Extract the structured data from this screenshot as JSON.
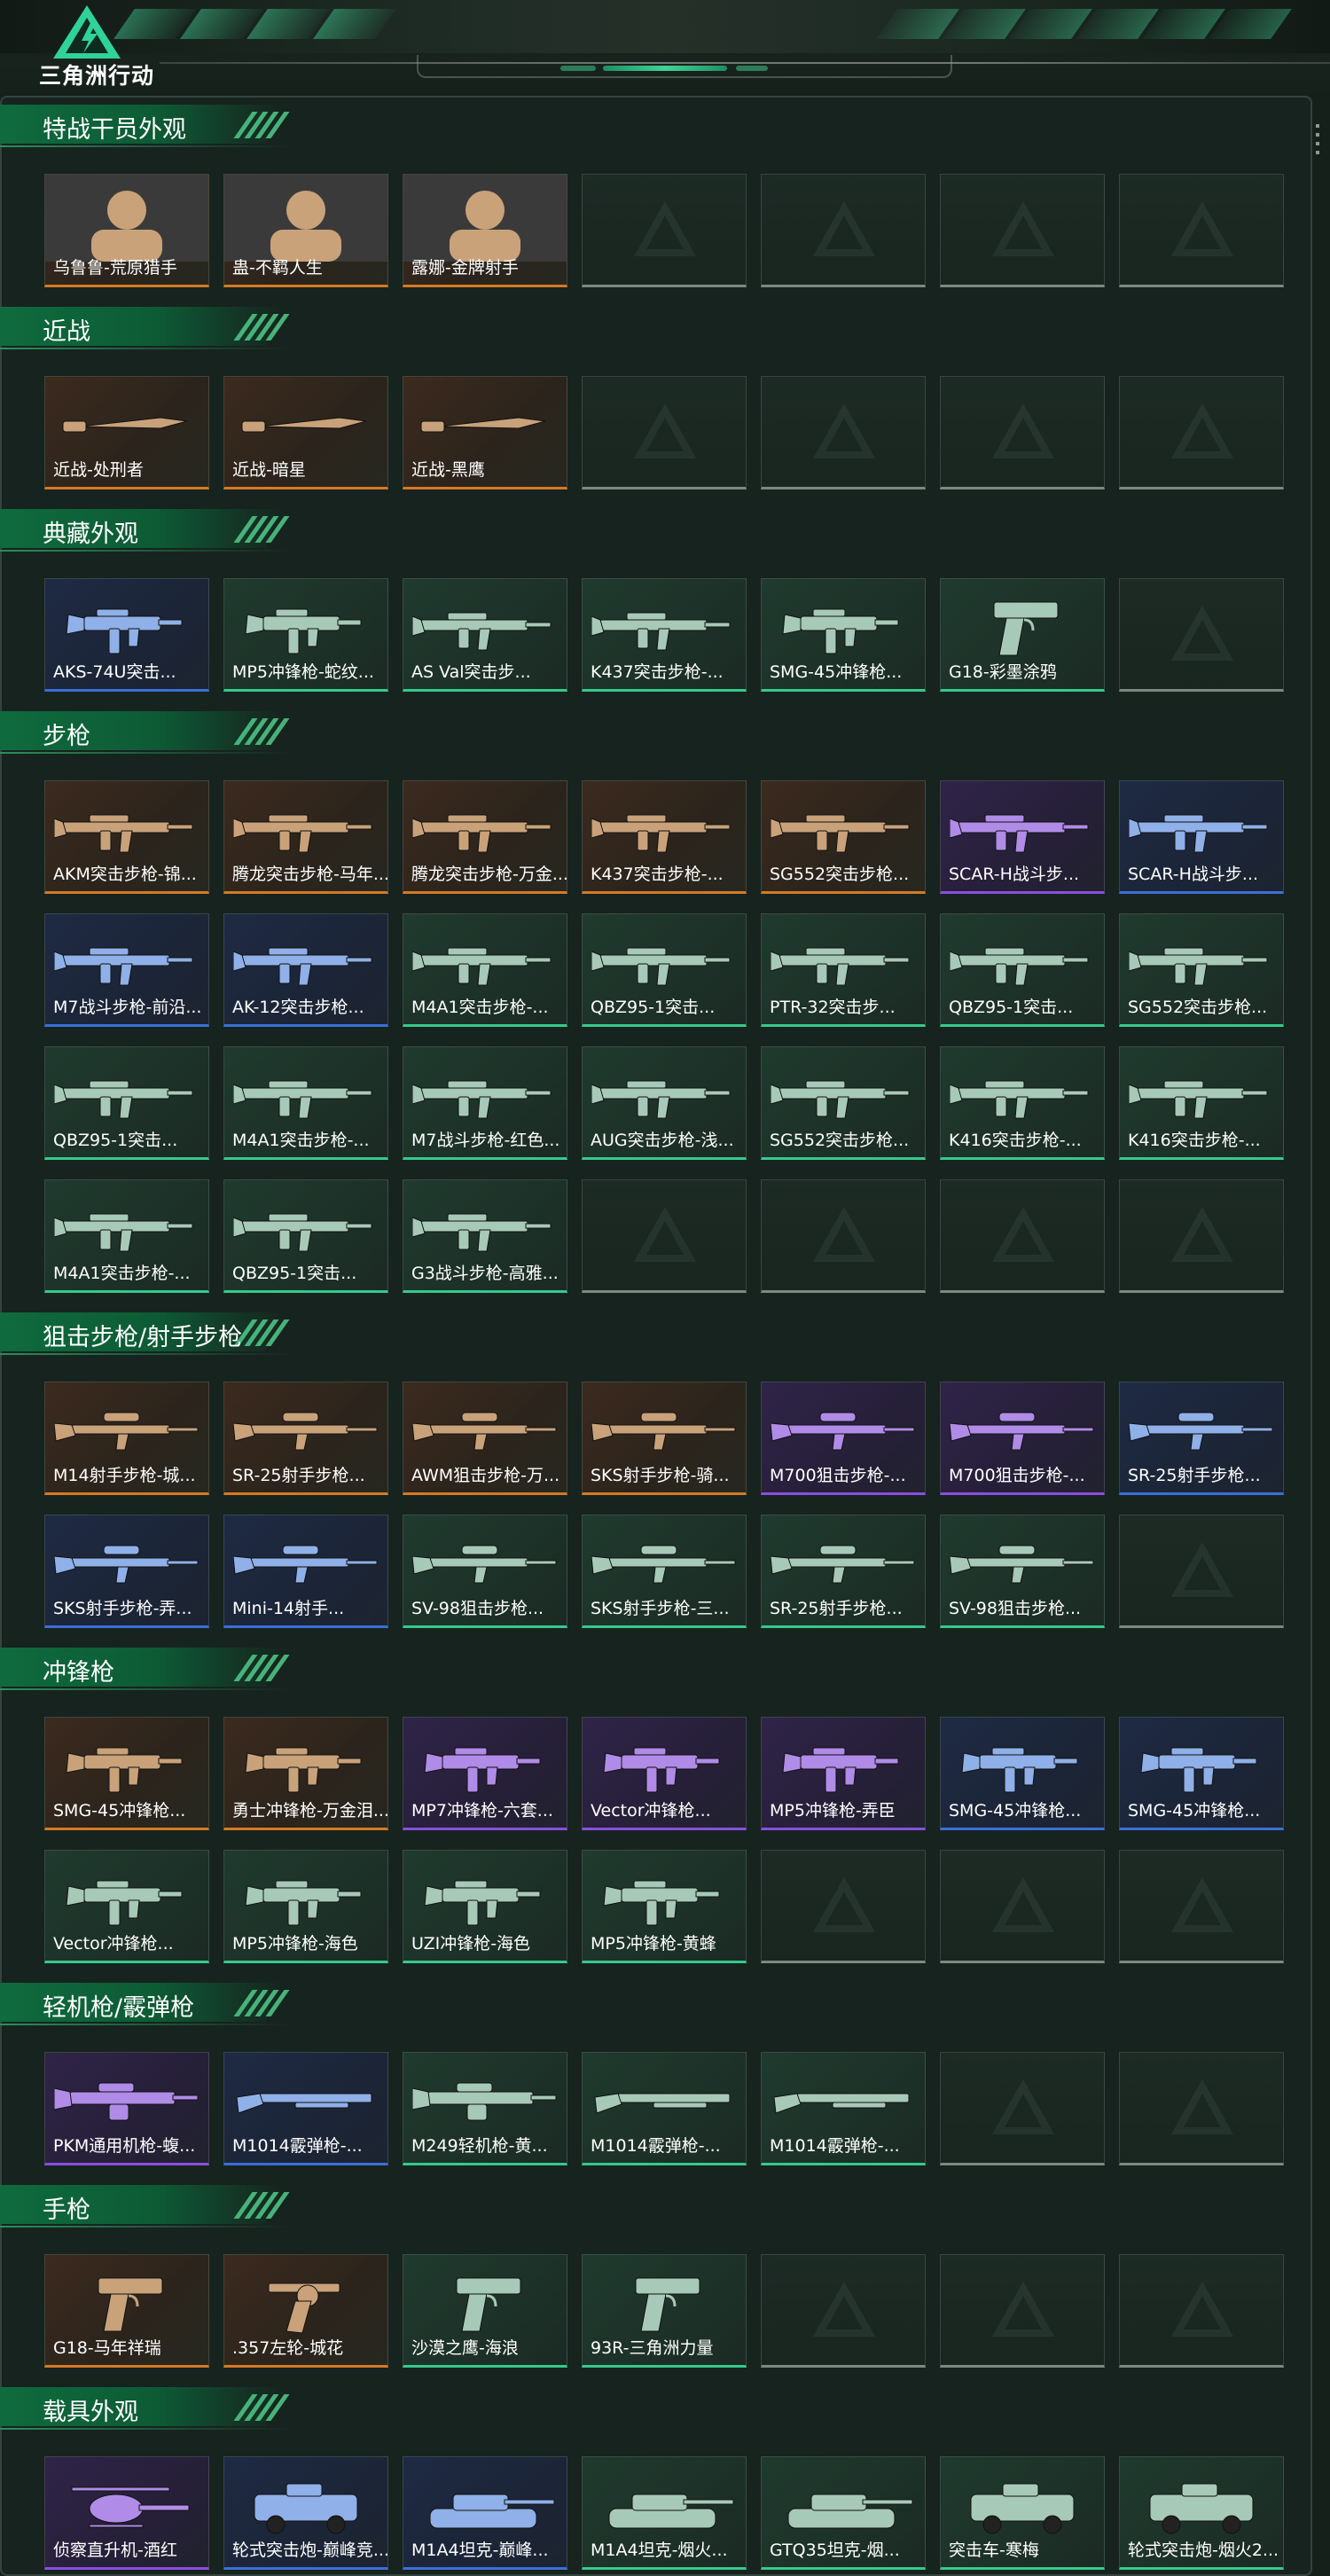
{
  "app": {
    "title": "三角洲行动"
  },
  "colors": {
    "orange": "#d47a24",
    "purple": "#8a4ee0",
    "blue": "#3a6fd8",
    "green": "#36c98c",
    "empty": "#7c8882"
  },
  "sections": [
    {
      "title": "特战干员外观",
      "rows": [
        [
          {
            "label": "乌鲁鲁-荒原猎手",
            "rarity": "orange",
            "icon": "operator-portrait"
          },
          {
            "label": "蛊-不羁人生",
            "rarity": "orange",
            "icon": "operator-portrait"
          },
          {
            "label": "露娜-金牌射手",
            "rarity": "orange",
            "icon": "operator-portrait"
          },
          {
            "label": "",
            "rarity": "empty"
          },
          {
            "label": "",
            "rarity": "empty"
          },
          {
            "label": "",
            "rarity": "empty"
          },
          {
            "label": "",
            "rarity": "empty"
          }
        ]
      ]
    },
    {
      "title": "近战",
      "rows": [
        [
          {
            "label": "近战-处刑者",
            "rarity": "orange",
            "icon": "melee-icon"
          },
          {
            "label": "近战-暗星",
            "rarity": "orange",
            "icon": "melee-icon"
          },
          {
            "label": "近战-黑鹰",
            "rarity": "orange",
            "icon": "melee-icon"
          },
          {
            "label": "",
            "rarity": "empty"
          },
          {
            "label": "",
            "rarity": "empty"
          },
          {
            "label": "",
            "rarity": "empty"
          },
          {
            "label": "",
            "rarity": "empty"
          }
        ]
      ]
    },
    {
      "title": "典藏外观",
      "rows": [
        [
          {
            "label": "AKS-74U突击...",
            "rarity": "blue",
            "icon": "smg-icon"
          },
          {
            "label": "MP5冲锋枪-蛇纹...",
            "rarity": "green",
            "icon": "smg-icon"
          },
          {
            "label": "AS Val突击步...",
            "rarity": "green",
            "icon": "rifle-icon"
          },
          {
            "label": "K437突击步枪-...",
            "rarity": "green",
            "icon": "rifle-icon"
          },
          {
            "label": "SMG-45冲锋枪...",
            "rarity": "green",
            "icon": "smg-icon"
          },
          {
            "label": "G18-彩墨涂鸦",
            "rarity": "green",
            "icon": "pistol-icon"
          },
          {
            "label": "",
            "rarity": "empty"
          }
        ]
      ]
    },
    {
      "title": "步枪",
      "rows": [
        [
          {
            "label": "AKM突击步枪-锦...",
            "rarity": "orange",
            "icon": "rifle-icon"
          },
          {
            "label": "腾龙突击步枪-马年...",
            "rarity": "orange",
            "icon": "rifle-icon"
          },
          {
            "label": "腾龙突击步枪-万金...",
            "rarity": "orange",
            "icon": "rifle-icon"
          },
          {
            "label": "K437突击步枪-...",
            "rarity": "orange",
            "icon": "rifle-icon"
          },
          {
            "label": "SG552突击步枪...",
            "rarity": "orange",
            "icon": "rifle-icon"
          },
          {
            "label": "SCAR-H战斗步...",
            "rarity": "purple",
            "icon": "rifle-icon"
          },
          {
            "label": "SCAR-H战斗步...",
            "rarity": "blue",
            "icon": "rifle-icon"
          }
        ],
        [
          {
            "label": "M7战斗步枪-前沿...",
            "rarity": "blue",
            "icon": "rifle-icon"
          },
          {
            "label": "AK-12突击步枪...",
            "rarity": "blue",
            "icon": "rifle-icon"
          },
          {
            "label": "M4A1突击步枪-...",
            "rarity": "green",
            "icon": "rifle-icon"
          },
          {
            "label": "QBZ95-1突击...",
            "rarity": "green",
            "icon": "rifle-icon"
          },
          {
            "label": "PTR-32突击步...",
            "rarity": "green",
            "icon": "rifle-icon"
          },
          {
            "label": "QBZ95-1突击...",
            "rarity": "green",
            "icon": "rifle-icon"
          },
          {
            "label": "SG552突击步枪...",
            "rarity": "green",
            "icon": "rifle-icon"
          }
        ],
        [
          {
            "label": "QBZ95-1突击...",
            "rarity": "green",
            "icon": "rifle-icon"
          },
          {
            "label": "M4A1突击步枪-...",
            "rarity": "green",
            "icon": "rifle-icon"
          },
          {
            "label": "M7战斗步枪-红色...",
            "rarity": "green",
            "icon": "rifle-icon"
          },
          {
            "label": "AUG突击步枪-浅...",
            "rarity": "green",
            "icon": "rifle-icon"
          },
          {
            "label": "SG552突击步枪...",
            "rarity": "green",
            "icon": "rifle-icon"
          },
          {
            "label": "K416突击步枪-...",
            "rarity": "green",
            "icon": "rifle-icon"
          },
          {
            "label": "K416突击步枪-...",
            "rarity": "green",
            "icon": "rifle-icon"
          }
        ],
        [
          {
            "label": "M4A1突击步枪-...",
            "rarity": "green",
            "icon": "rifle-icon"
          },
          {
            "label": "QBZ95-1突击...",
            "rarity": "green",
            "icon": "rifle-icon"
          },
          {
            "label": "G3战斗步枪-高雅...",
            "rarity": "green",
            "icon": "rifle-icon"
          },
          {
            "label": "",
            "rarity": "empty"
          },
          {
            "label": "",
            "rarity": "empty"
          },
          {
            "label": "",
            "rarity": "empty"
          },
          {
            "label": "",
            "rarity": "empty"
          }
        ]
      ]
    },
    {
      "title": "狙击步枪/射手步枪",
      "rows": [
        [
          {
            "label": "M14射手步枪-城...",
            "rarity": "orange",
            "icon": "sniper-icon"
          },
          {
            "label": "SR-25射手步枪...",
            "rarity": "orange",
            "icon": "sniper-icon"
          },
          {
            "label": "AWM狙击步枪-万...",
            "rarity": "orange",
            "icon": "sniper-icon"
          },
          {
            "label": "SKS射手步枪-骑...",
            "rarity": "orange",
            "icon": "sniper-icon"
          },
          {
            "label": "M700狙击步枪-...",
            "rarity": "purple",
            "icon": "sniper-icon"
          },
          {
            "label": "M700狙击步枪-...",
            "rarity": "purple",
            "icon": "sniper-icon"
          },
          {
            "label": "SR-25射手步枪...",
            "rarity": "blue",
            "icon": "sniper-icon"
          }
        ],
        [
          {
            "label": "SKS射手步枪-弄...",
            "rarity": "blue",
            "icon": "sniper-icon"
          },
          {
            "label": "Mini-14射手...",
            "rarity": "blue",
            "icon": "sniper-icon"
          },
          {
            "label": "SV-98狙击步枪...",
            "rarity": "green",
            "icon": "sniper-icon"
          },
          {
            "label": "SKS射手步枪-三...",
            "rarity": "green",
            "icon": "sniper-icon"
          },
          {
            "label": "SR-25射手步枪...",
            "rarity": "green",
            "icon": "sniper-icon"
          },
          {
            "label": "SV-98狙击步枪...",
            "rarity": "green",
            "icon": "sniper-icon"
          },
          {
            "label": "",
            "rarity": "empty"
          }
        ]
      ]
    },
    {
      "title": "冲锋枪",
      "rows": [
        [
          {
            "label": "SMG-45冲锋枪...",
            "rarity": "orange",
            "icon": "smg-icon"
          },
          {
            "label": "勇士冲锋枪-万金泪...",
            "rarity": "orange",
            "icon": "smg-icon"
          },
          {
            "label": "MP7冲锋枪-六套...",
            "rarity": "purple",
            "icon": "smg-icon"
          },
          {
            "label": "Vector冲锋枪...",
            "rarity": "purple",
            "icon": "smg-icon"
          },
          {
            "label": "MP5冲锋枪-弄臣",
            "rarity": "purple",
            "icon": "smg-icon"
          },
          {
            "label": "SMG-45冲锋枪...",
            "rarity": "blue",
            "icon": "smg-icon"
          },
          {
            "label": "SMG-45冲锋枪...",
            "rarity": "blue",
            "icon": "smg-icon"
          }
        ],
        [
          {
            "label": "Vector冲锋枪...",
            "rarity": "green",
            "icon": "smg-icon"
          },
          {
            "label": "MP5冲锋枪-海色",
            "rarity": "green",
            "icon": "smg-icon"
          },
          {
            "label": "UZI冲锋枪-海色",
            "rarity": "green",
            "icon": "smg-icon"
          },
          {
            "label": "MP5冲锋枪-黄蜂",
            "rarity": "green",
            "icon": "smg-icon"
          },
          {
            "label": "",
            "rarity": "empty"
          },
          {
            "label": "",
            "rarity": "empty"
          },
          {
            "label": "",
            "rarity": "empty"
          }
        ]
      ]
    },
    {
      "title": "轻机枪/霰弹枪",
      "rows": [
        [
          {
            "label": "PKM通用机枪-蝮...",
            "rarity": "purple",
            "icon": "lmg-icon"
          },
          {
            "label": "M1014霰弹枪-...",
            "rarity": "blue",
            "icon": "shotgun-icon"
          },
          {
            "label": "M249轻机枪-黄...",
            "rarity": "green",
            "icon": "lmg-icon"
          },
          {
            "label": "M1014霰弹枪-...",
            "rarity": "green",
            "icon": "shotgun-icon"
          },
          {
            "label": "M1014霰弹枪-...",
            "rarity": "green",
            "icon": "shotgun-icon"
          },
          {
            "label": "",
            "rarity": "empty"
          },
          {
            "label": "",
            "rarity": "empty"
          }
        ]
      ]
    },
    {
      "title": "手枪",
      "rows": [
        [
          {
            "label": "G18-马年祥瑞",
            "rarity": "orange",
            "icon": "pistol-icon"
          },
          {
            "label": ".357左轮-城花",
            "rarity": "orange",
            "icon": "revolver-icon"
          },
          {
            "label": "沙漠之鹰-海浪",
            "rarity": "green",
            "icon": "pistol-icon"
          },
          {
            "label": "93R-三角洲力量",
            "rarity": "green",
            "icon": "pistol-icon"
          },
          {
            "label": "",
            "rarity": "empty"
          },
          {
            "label": "",
            "rarity": "empty"
          },
          {
            "label": "",
            "rarity": "empty"
          }
        ]
      ]
    },
    {
      "title": "载具外观",
      "rows": [
        [
          {
            "label": "侦察直升机-酒红",
            "rarity": "purple",
            "icon": "helicopter-icon"
          },
          {
            "label": "轮式突击炮-巅峰竞...",
            "rarity": "blue",
            "icon": "vehicle-icon"
          },
          {
            "label": "M1A4坦克-巅峰...",
            "rarity": "blue",
            "icon": "tank-icon"
          },
          {
            "label": "M1A4坦克-烟火...",
            "rarity": "green",
            "icon": "tank-icon"
          },
          {
            "label": "GTQ35坦克-烟...",
            "rarity": "green",
            "icon": "tank-icon"
          },
          {
            "label": "突击车-寒梅",
            "rarity": "green",
            "icon": "vehicle-icon"
          },
          {
            "label": "轮式突击炮-烟火2...",
            "rarity": "green",
            "icon": "vehicle-icon"
          }
        ]
      ]
    }
  ]
}
